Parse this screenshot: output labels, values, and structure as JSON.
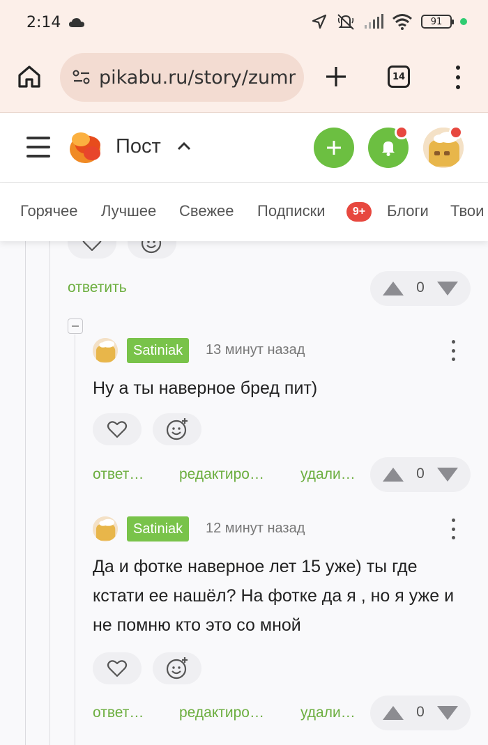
{
  "status": {
    "time": "2:14",
    "battery": "91"
  },
  "browser": {
    "url": "pikabu.ru/story/zumm",
    "tab_count": "14"
  },
  "header": {
    "title": "Пост"
  },
  "nav": {
    "tabs": [
      "Горячее",
      "Лучшее",
      "Свежее",
      "Подписки",
      "Блоги",
      "Твои"
    ],
    "subscriptions_badge": "9+"
  },
  "parent_comment": {
    "reply_label": "ответить",
    "rating": "0"
  },
  "comments": [
    {
      "username": "Satiniak",
      "time": "13 минут назад",
      "text": "Ну а ты наверное бред пит)",
      "reply_label": "ответ…",
      "edit_label": "редактиро…",
      "delete_label": "удали…",
      "rating": "0"
    },
    {
      "username": "Satiniak",
      "time": "12 минут назад",
      "text": "Да и фотке наверное лет 15 уже) ты где кстати ее нашёл? На фотке да я , но я уже и не помню кто это со мной",
      "reply_label": "ответ…",
      "edit_label": "редактиро…",
      "delete_label": "удали…",
      "rating": "0"
    }
  ],
  "colors": {
    "accent_green": "#6cbf41",
    "username_bg": "#79c34a",
    "action_text": "#6cae3f",
    "badge_red": "#e7483f",
    "browser_bg": "#fcefe9"
  }
}
